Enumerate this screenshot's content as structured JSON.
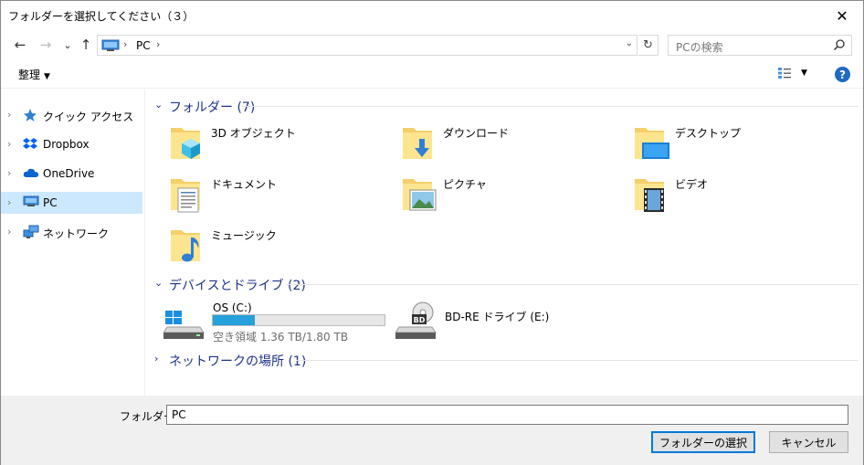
{
  "window": {
    "title": "フォルダーを選択してください（３）",
    "close_glyph": "✕"
  },
  "nav": {
    "back_glyph": "←",
    "forward_glyph": "→",
    "recent_glyph": "⌄",
    "up_glyph": "↑"
  },
  "address": {
    "separator": "›",
    "location": "PC",
    "dropdown_glyph": "⌄",
    "refresh_glyph": "↻"
  },
  "search": {
    "placeholder": "PCの検索"
  },
  "toolbar": {
    "organize_label": "整理",
    "caret": "▼",
    "help_label": "?"
  },
  "sidebar": {
    "chevron": "›",
    "items": [
      {
        "label": "クイック アクセス",
        "icon": "star-icon"
      },
      {
        "label": "Dropbox",
        "icon": "dropbox-icon"
      },
      {
        "label": "OneDrive",
        "icon": "cloud-icon"
      },
      {
        "label": "PC",
        "icon": "pc-icon",
        "selected": true
      },
      {
        "label": "ネットワーク",
        "icon": "network-icon"
      }
    ]
  },
  "groups": {
    "chevron_open": "⌄",
    "chevron_closed": "›",
    "folders_title": "フォルダー (7)",
    "drives_title": "デバイスとドライブ (2)",
    "network_title": "ネットワークの場所 (1)"
  },
  "folders": [
    {
      "label": "3D オブジェクト",
      "icon": "3d-objects-folder-icon"
    },
    {
      "label": "ダウンロード",
      "icon": "downloads-folder-icon"
    },
    {
      "label": "デスクトップ",
      "icon": "desktop-folder-icon"
    },
    {
      "label": "ドキュメント",
      "icon": "documents-folder-icon"
    },
    {
      "label": "ピクチャ",
      "icon": "pictures-folder-icon"
    },
    {
      "label": "ビデオ",
      "icon": "videos-folder-icon"
    },
    {
      "label": "ミュージック",
      "icon": "music-folder-icon"
    }
  ],
  "drives": [
    {
      "label": "OS (C:)",
      "space": "空き領域 1.36 TB/1.80 TB",
      "used_fraction": 0.244,
      "icon": "windows-drive-icon"
    },
    {
      "label": "BD-RE ドライブ (E:)",
      "icon": "bd-drive-icon",
      "badge": "BD"
    }
  ],
  "footer": {
    "folder_label": "フォルダー:",
    "folder_value": "PC",
    "select_button": "フォルダーの選択",
    "cancel_button": "キャンセル"
  },
  "colors": {
    "accent": "#0078d7",
    "selection": "#cce8ff",
    "group_header": "#1e3287",
    "drive_fill": "#26a0da"
  }
}
